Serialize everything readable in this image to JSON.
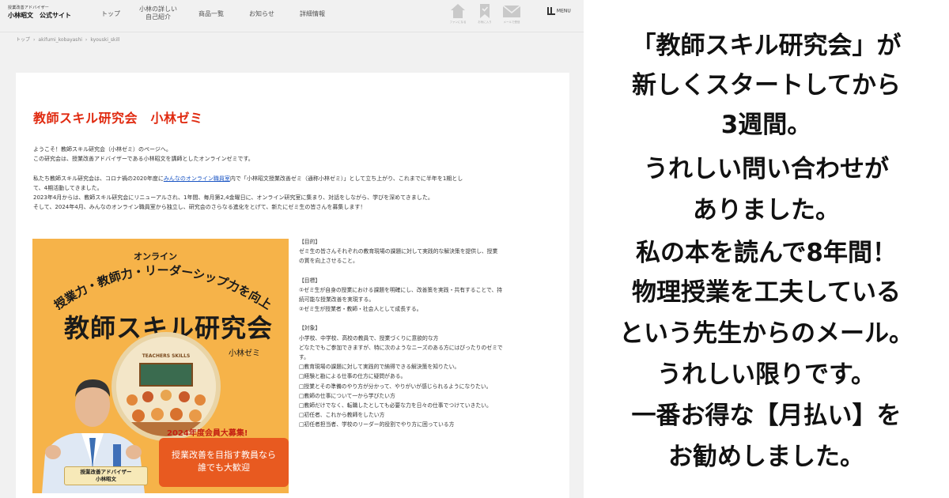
{
  "header": {
    "logo_small": "授業改善アドバイザー",
    "logo_main": "小林昭文　公式サイト",
    "nav": [
      {
        "label": "トップ"
      },
      {
        "label": "小林の詳しい",
        "label2": "自己紹介"
      },
      {
        "label": "商品一覧"
      },
      {
        "label": "お知らせ"
      },
      {
        "label": "詳細情報"
      }
    ],
    "icons": [
      {
        "name": "home-icon",
        "label": "ファンになる"
      },
      {
        "name": "bookmark-icon",
        "label": "お気に入り"
      },
      {
        "name": "mail-icon",
        "label": "メールで受信"
      }
    ],
    "menu_label": "MENU"
  },
  "breadcrumb": [
    "トップ",
    "akifumi_kobayashi",
    "kyouski_skill"
  ],
  "page": {
    "title": "教師スキル研究会　小林ゼミ",
    "intro": {
      "p1": "ようこそ！教師スキル研究会（小林ゼミ）のページへ。",
      "p2": "この研究会は、授業改善アドバイザーである小林昭文を講師としたオンラインゼミです。",
      "p3_pre": "私たち教師スキル研究会は、コロナ禍の2020年度に",
      "p3_link": "みんなのオンライン職員室",
      "p3_post": "内で「小林昭文授業改善ゼミ（通称小林ゼミ）」として立ち上がり、これまでに半年を1期とし",
      "p4": "て、4期活動してきました。",
      "p5": "2023年4月からは、教師スキル研究会にリニューアルされ、1年間、毎月第2,4金曜日に、オンライン研究室に集まり、対話をしながら、学びを深めてきました。",
      "p6": "そして、2024年4月、みんなのオンライン職員室から独立し、研究会のさらなる進化をとげて、新たにゼミ生の皆さんを募集します！"
    }
  },
  "promo": {
    "online": "オンライン",
    "arc_text": "授業力・教師力・リーダーシップ力を向上",
    "title": "教師スキル研究会",
    "zemi": "小林ゼミ",
    "badge_text": "TEACHERS SKILLS",
    "recruit": "2024年度会員大募集!",
    "pill_line1": "授業改善を目指す教員なら",
    "pill_line2": "誰でも大歓迎",
    "person_label1": "授業改善アドバイザー",
    "person_label2": "小林昭文"
  },
  "details": {
    "purpose_h": "【目的】",
    "purpose_1": "ゼミ生の皆さんそれぞれの教育現場の課題に対して実践的な解決策を提供し、授業",
    "purpose_2": "の質を向上させること。",
    "goal_h": "【目標】",
    "goal_1": "①ゼミ生が自身の授業における課題を明確にし、改善策を実践・共有することで、持",
    "goal_2": "続可能な授業改善を実現する。",
    "goal_3": "②ゼミ生が授業者・教師・社会人として成長する。",
    "target_h": "【対象】",
    "target_1": "小学校、中学校、高校の教員で、授業づくりに意欲的な方",
    "target_2": "どなたでもご参加できますが、特に次のようなニーズのある方にはぴったりのゼミで",
    "target_3": "す。",
    "checks": [
      "□教育現場の課題に対して実践的で納得できる解決策を知りたい。",
      "□経験と勘による仕事の仕方に疑問がある。",
      "□授業とその準備のやり方が分かって、やりがいが感じられるようになりたい。",
      "□教師の仕事について一から学びたい方",
      "□教師だけでなく、転職したとしても必要な力を日々の仕事でつけていきたい。",
      "□初任者、これから教師をしたい方",
      "□初任者担当者、学校のリーダー的役割でやり方に困っている方"
    ]
  },
  "side_message": [
    "「教師スキル研究会」が",
    "新しくスタートしてから",
    "3週間。",
    "うれしい問い合わせが",
    "ありました。",
    "私の本を読んで8年間！",
    "物理授業を工夫している",
    "という先生からのメール。",
    "うれしい限りです。",
    "一番お得な【月払い】を",
    "お勧めしました。"
  ],
  "colors": {
    "title_red": "#e02a10",
    "link_blue": "#1a55c4",
    "promo_bg": "#f6b349",
    "promo_pill": "#e85a20"
  }
}
